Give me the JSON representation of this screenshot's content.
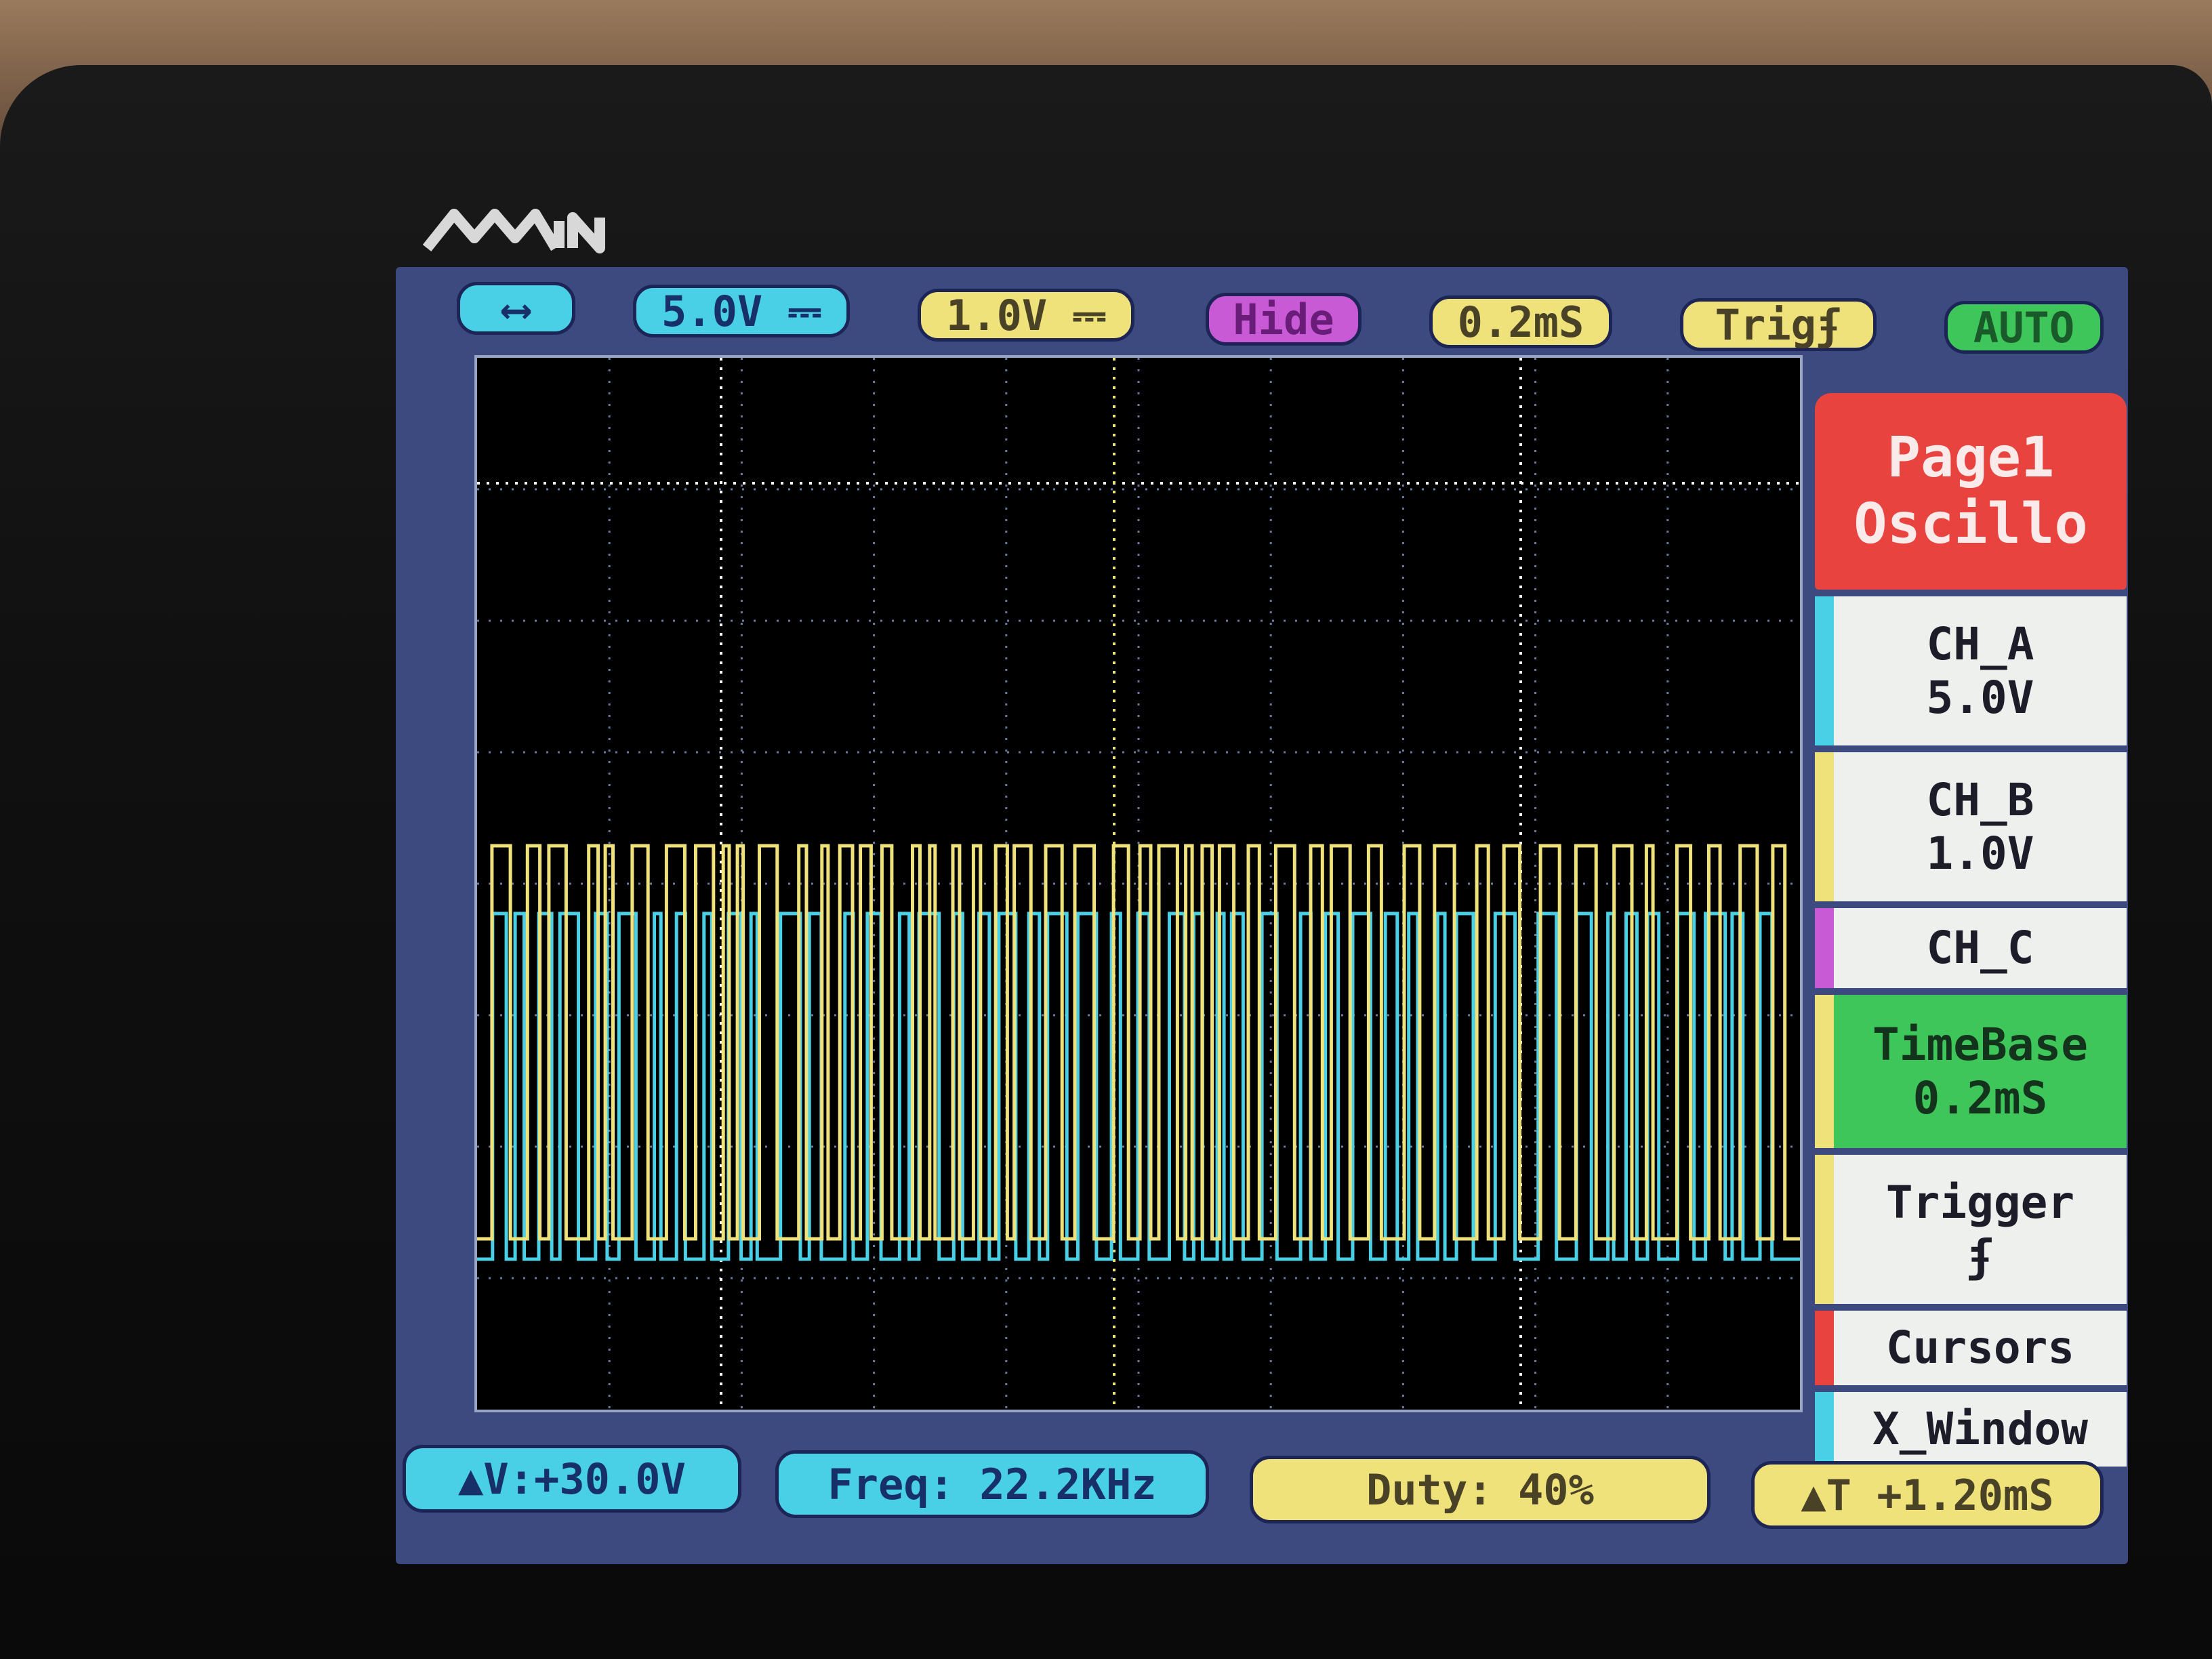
{
  "logo": {
    "text": "MiN"
  },
  "top_bar": {
    "usb_icon": "usb-icon",
    "ch_a_volt": "5.0V",
    "ch_b_volt": "1.0V",
    "ch_c_mode": "Hide",
    "timebase": "0.2mS",
    "trigger": "Trig",
    "run_mode": "AUTO"
  },
  "side_menu": {
    "page_line1": "Page1",
    "page_line2": "Oscillo",
    "ch_a_label": "CH_A",
    "ch_a_value": "5.0V",
    "ch_b_label": "CH_B",
    "ch_b_value": "1.0V",
    "ch_c_label": "CH_C",
    "timebase_label": "TimeBase",
    "timebase_value": "0.2mS",
    "trigger_label": "Trigger",
    "cursors_label": "Cursors",
    "xwindow_label": "X_Window"
  },
  "bottom_bar": {
    "delta_v": "▲V:+30.0V",
    "freq": "Freq: 22.2KHz",
    "duty": "Duty: 40%",
    "delta_t": "▲T +1.20mS"
  },
  "colors": {
    "ch_a": "#4ad0e6",
    "ch_b": "#efe27a",
    "ch_c": "#c95ad6",
    "timebase": "#3ec65a",
    "page": "#e8433e"
  }
}
